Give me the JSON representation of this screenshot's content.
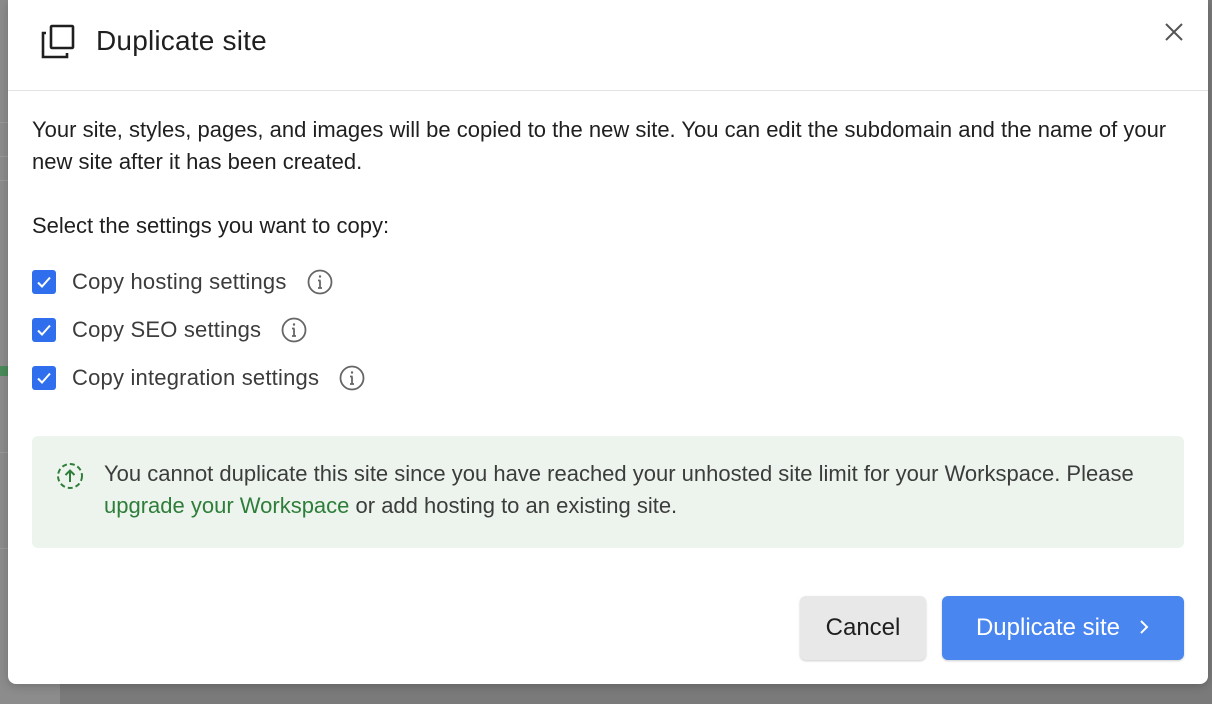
{
  "dialog": {
    "title": "Duplicate site",
    "header_icon": "duplicate-icon",
    "close_icon": "close-icon"
  },
  "body": {
    "intro": "Your site, styles, pages, and images will be copied to the new site. You can edit the subdomain and the name of your new site after it has been created.",
    "select_label": "Select the settings you want to copy:",
    "options": [
      {
        "label": "Copy hosting settings",
        "checked": true,
        "icon": "info-icon"
      },
      {
        "label": "Copy SEO settings",
        "checked": true,
        "icon": "info-icon"
      },
      {
        "label": "Copy integration settings",
        "checked": true,
        "icon": "info-icon"
      }
    ]
  },
  "notice": {
    "icon": "upload-circle-icon",
    "text_before": "You cannot duplicate this site since you have reached your unhosted site limit for your Workspace. Please ",
    "link_text": "upgrade your Workspace",
    "text_after": " or add hosting to an existing site."
  },
  "footer": {
    "cancel_label": "Cancel",
    "primary_label": "Duplicate site",
    "primary_icon": "chevron-right-icon"
  },
  "colors": {
    "accent": "#4a86f0",
    "checkbox": "#2f6fed",
    "notice_bg": "#edf4ed",
    "link": "#2e7d3a"
  }
}
